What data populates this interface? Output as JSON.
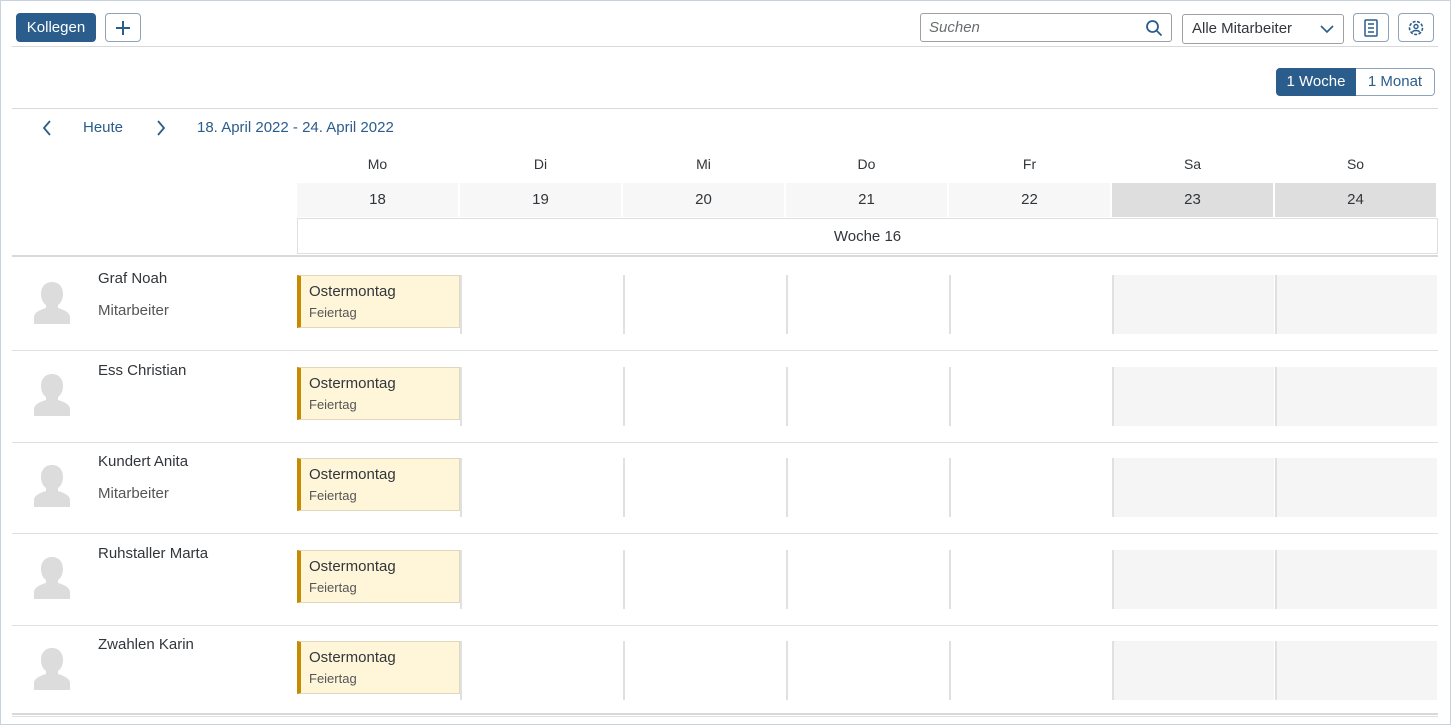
{
  "toolbar": {
    "colleagues_label": "Kollegen",
    "search_placeholder": "Suchen",
    "employee_filter": "Alle Mitarbeiter"
  },
  "view_switch": {
    "week": "1 Woche",
    "month": "1 Monat",
    "selected": "week"
  },
  "nav": {
    "today": "Heute",
    "range": "18. April 2022 - 24. April 2022"
  },
  "days": [
    {
      "name": "Mo",
      "date": "18",
      "weekend": false
    },
    {
      "name": "Di",
      "date": "19",
      "weekend": false
    },
    {
      "name": "Mi",
      "date": "20",
      "weekend": false
    },
    {
      "name": "Do",
      "date": "21",
      "weekend": false
    },
    {
      "name": "Fr",
      "date": "22",
      "weekend": false
    },
    {
      "name": "Sa",
      "date": "23",
      "weekend": true
    },
    {
      "name": "So",
      "date": "24",
      "weekend": true
    }
  ],
  "week_label": "Woche 16",
  "people": [
    {
      "name": "Graf Noah",
      "role": "Mitarbeiter",
      "appointment": {
        "title": "Ostermontag",
        "type": "Feiertag"
      }
    },
    {
      "name": "Ess Christian",
      "role": "",
      "appointment": {
        "title": "Ostermontag",
        "type": "Feiertag"
      }
    },
    {
      "name": "Kundert Anita",
      "role": "Mitarbeiter",
      "appointment": {
        "title": "Ostermontag",
        "type": "Feiertag"
      }
    },
    {
      "name": "Ruhstaller Marta",
      "role": "",
      "appointment": {
        "title": "Ostermontag",
        "type": "Feiertag"
      }
    },
    {
      "name": "Zwahlen Karin",
      "role": "",
      "appointment": {
        "title": "Ostermontag",
        "type": "Feiertag"
      }
    }
  ],
  "colors": {
    "accent": "#2a5c8c",
    "holiday_bg": "#fff6da",
    "holiday_bar": "#c88b00"
  }
}
